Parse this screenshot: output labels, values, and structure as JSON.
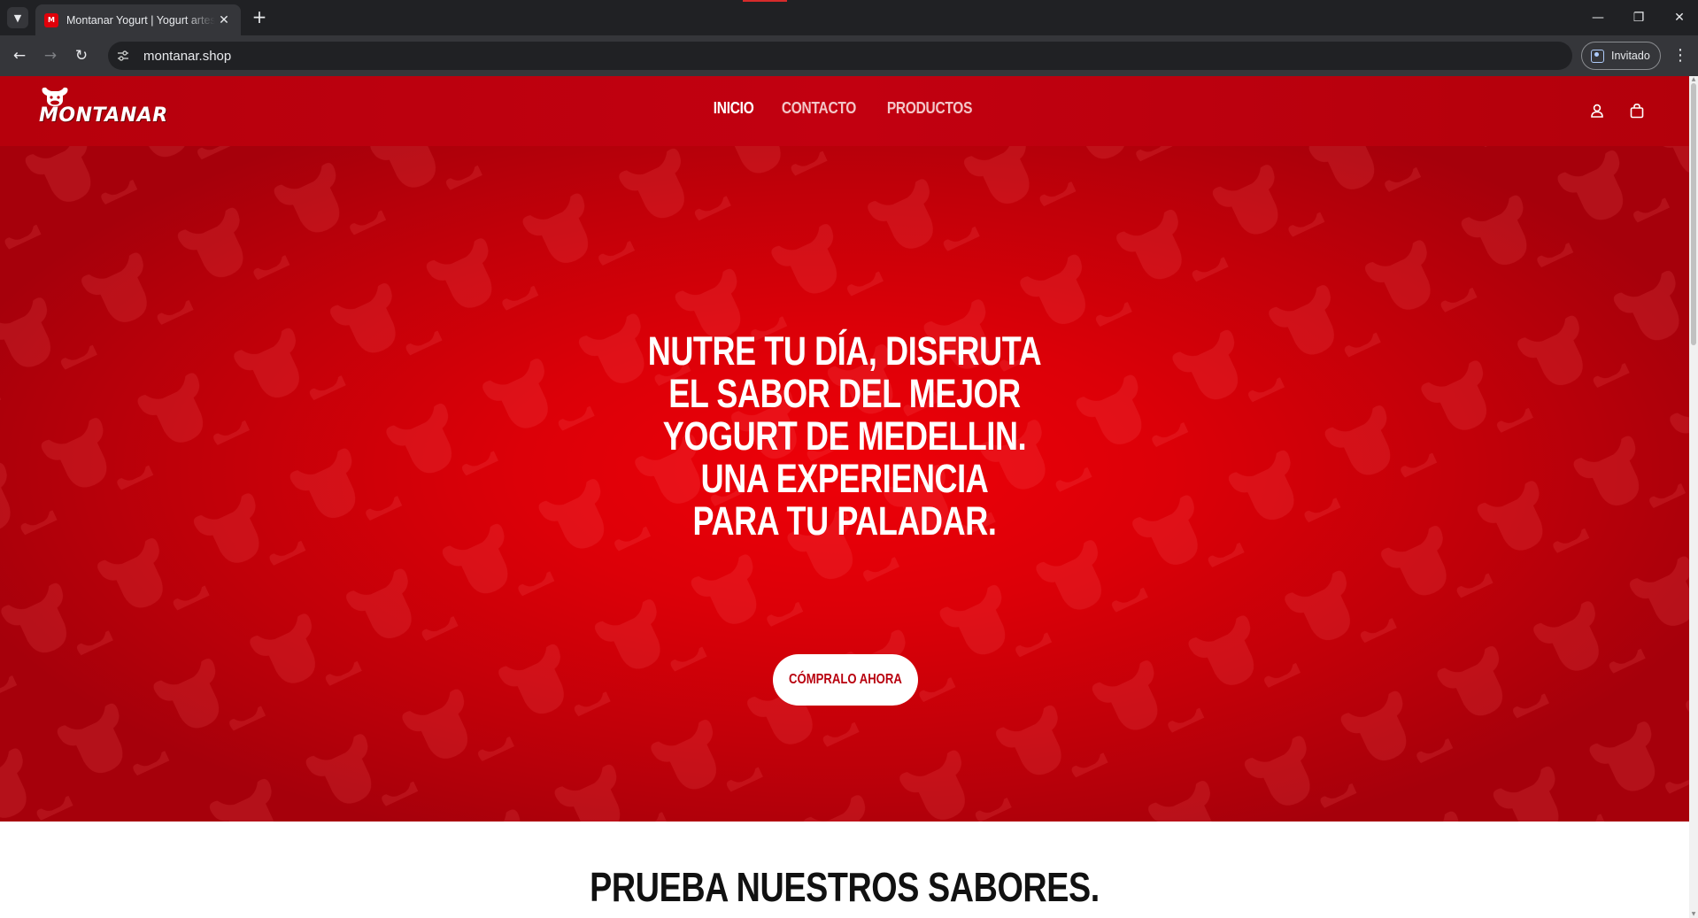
{
  "browser": {
    "tab_title": "Montanar Yogurt | Yogurt artesanal",
    "url": "montanar.shop",
    "profile_label": "Invitado",
    "icons": {
      "tab_search": "chevron-down-icon",
      "tab_close": "close-icon",
      "new_tab": "plus-icon",
      "back": "arrow-left-icon",
      "forward": "arrow-right-icon",
      "reload": "reload-icon",
      "site_info": "tune-icon",
      "menu": "kebab-menu-icon",
      "minimize": "minimize-icon",
      "restore": "restore-icon",
      "close_window": "close-icon"
    }
  },
  "site": {
    "logo_text": "MONTANAR",
    "nav": [
      {
        "label": "INICIO",
        "active": true
      },
      {
        "label": "CONTACTO",
        "active": false
      },
      {
        "label": "PRODUCTOS",
        "active": false
      }
    ],
    "header_icons": [
      "account-icon",
      "bag-icon"
    ],
    "hero": {
      "lines": [
        "NUTRE TU DÍA, DISFRUTA",
        "EL SABOR DEL MEJOR",
        "YOGURT DE MEDELLIN.",
        "UNA EXPERIENCIA",
        "PARA TU PALADAR."
      ],
      "cta_label": "CÓMPRALO AHORA"
    },
    "flavors_title": "PRUEBA NUESTROS SABORES.",
    "colors": {
      "brand_red": "#c20010",
      "hero_center": "#ee0008",
      "cta_text": "#b8000e",
      "browser_dark": "#202124"
    }
  }
}
